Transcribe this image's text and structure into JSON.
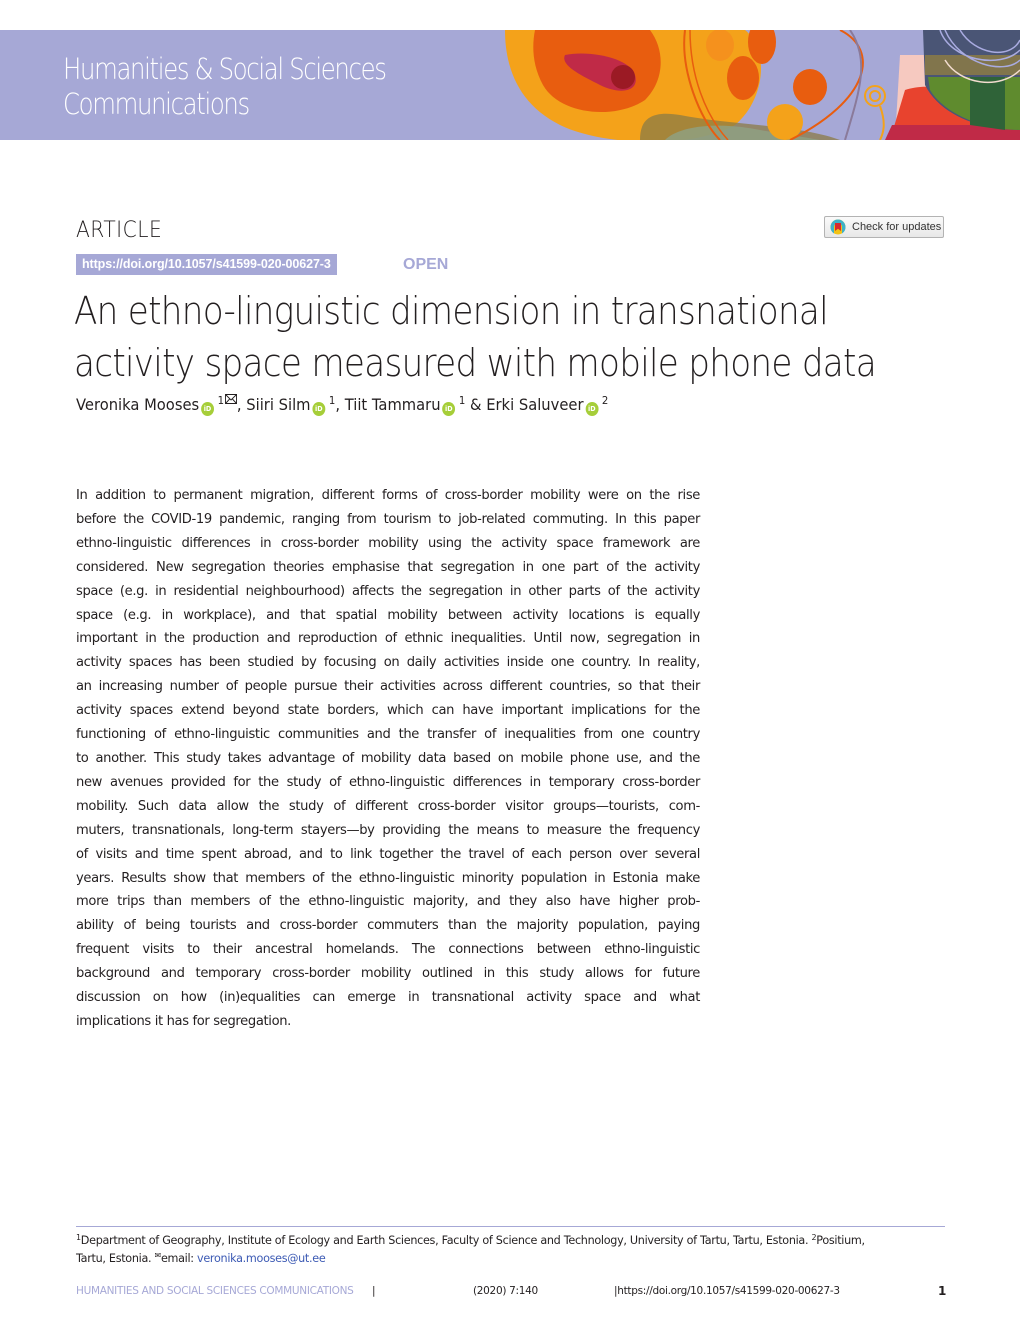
{
  "banner": {
    "journal_line1": "Humanities & Social Sciences",
    "journal_line2": "Communications",
    "background_color": "#a6a8d6"
  },
  "header": {
    "article_type": "ARTICLE",
    "doi_link": "https://doi.org/10.1057/s41599-020-00627-3",
    "access_label": "OPEN",
    "check_updates_label": "Check for updates"
  },
  "title": {
    "line1": "An ethno-linguistic dimension in transnational",
    "line2": "activity space measured with mobile phone data"
  },
  "authors": [
    {
      "name": "Veronika Mooses",
      "affiliation": "1",
      "corresponding": true,
      "orcid_icon": "orcid-icon"
    },
    {
      "name": "Siiri Silm",
      "affiliation": "1",
      "corresponding": false,
      "orcid_icon": "orcid-icon"
    },
    {
      "name": "Tiit Tammaru",
      "affiliation": "1",
      "corresponding": false,
      "orcid_icon": "orcid-icon"
    },
    {
      "name": "Erki Saluveer",
      "affiliation": "2",
      "corresponding": false,
      "orcid_icon": "orcid-icon"
    }
  ],
  "author_separators": [
    ", ",
    ", ",
    " & "
  ],
  "abstract": {
    "lines": [
      "In addition to permanent migration, different forms of cross-border mobility were on the rise",
      "before the COVID-19 pandemic, ranging from tourism to job-related commuting. In this paper",
      "ethno-linguistic differences in cross-border mobility using the activity space framework are",
      "considered. New segregation theories emphasise that segregation in one part of the activity",
      "space (e.g. in residential neighbourhood) affects the segregation in other parts of the activity",
      "space (e.g. in workplace), and that spatial mobility between activity locations is equally",
      "important in the production and reproduction of ethnic inequalities. Until now, segregation in",
      "activity spaces has been studied by focusing on daily activities inside one country. In reality,",
      "an increasing number of people pursue their activities across different countries, so that their",
      "activity spaces extend beyond state borders, which can have important implications for the",
      "functioning of ethno-linguistic communities and the transfer of inequalities from one country",
      "to another. This study takes advantage of mobility data based on mobile phone use, and the",
      "new avenues provided for the study of ethno-linguistic differences in temporary cross-border",
      "mobility. Such data allow the study of different cross-border visitor groups—tourists, com-",
      "muters, transnationals, long-term stayers—by providing the means to measure the frequency",
      "of visits and time spent abroad, and to link together the travel of each person over several",
      "years. Results show that members of the ethno-linguistic minority population in Estonia make",
      "more trips than members of the ethno-linguistic majority, and they also have higher prob-",
      "ability of being tourists and cross-border commuters than the majority population, paying",
      "frequent visits to their ancestral homelands. The connections between ethno-linguistic",
      "background and temporary cross-border mobility outlined in this study allows for future",
      "discussion on how (in)equalities can emerge in transnational activity space and what",
      "implications it has for segregation."
    ]
  },
  "footnote": {
    "aff1_mark": "1",
    "aff1_text": "Department of Geography, Institute of Ecology and Earth Sciences, Faculty of Science and Technology, University of Tartu, Tartu, Estonia.",
    "aff2_mark": "2",
    "aff2_text_a": "Positium,",
    "aff2_text_b": "Tartu, Estonia.",
    "email_label": "email:",
    "email": "veronika.mooses@ut.ee"
  },
  "footer": {
    "journal": "HUMANITIES AND SOCIAL SCIENCES COMMUNICATIONS",
    "separator": "|",
    "citation": "(2020)  7:140",
    "doi": "|https://doi.org/10.1057/s41599-020-00627-3",
    "page_number": "1"
  }
}
